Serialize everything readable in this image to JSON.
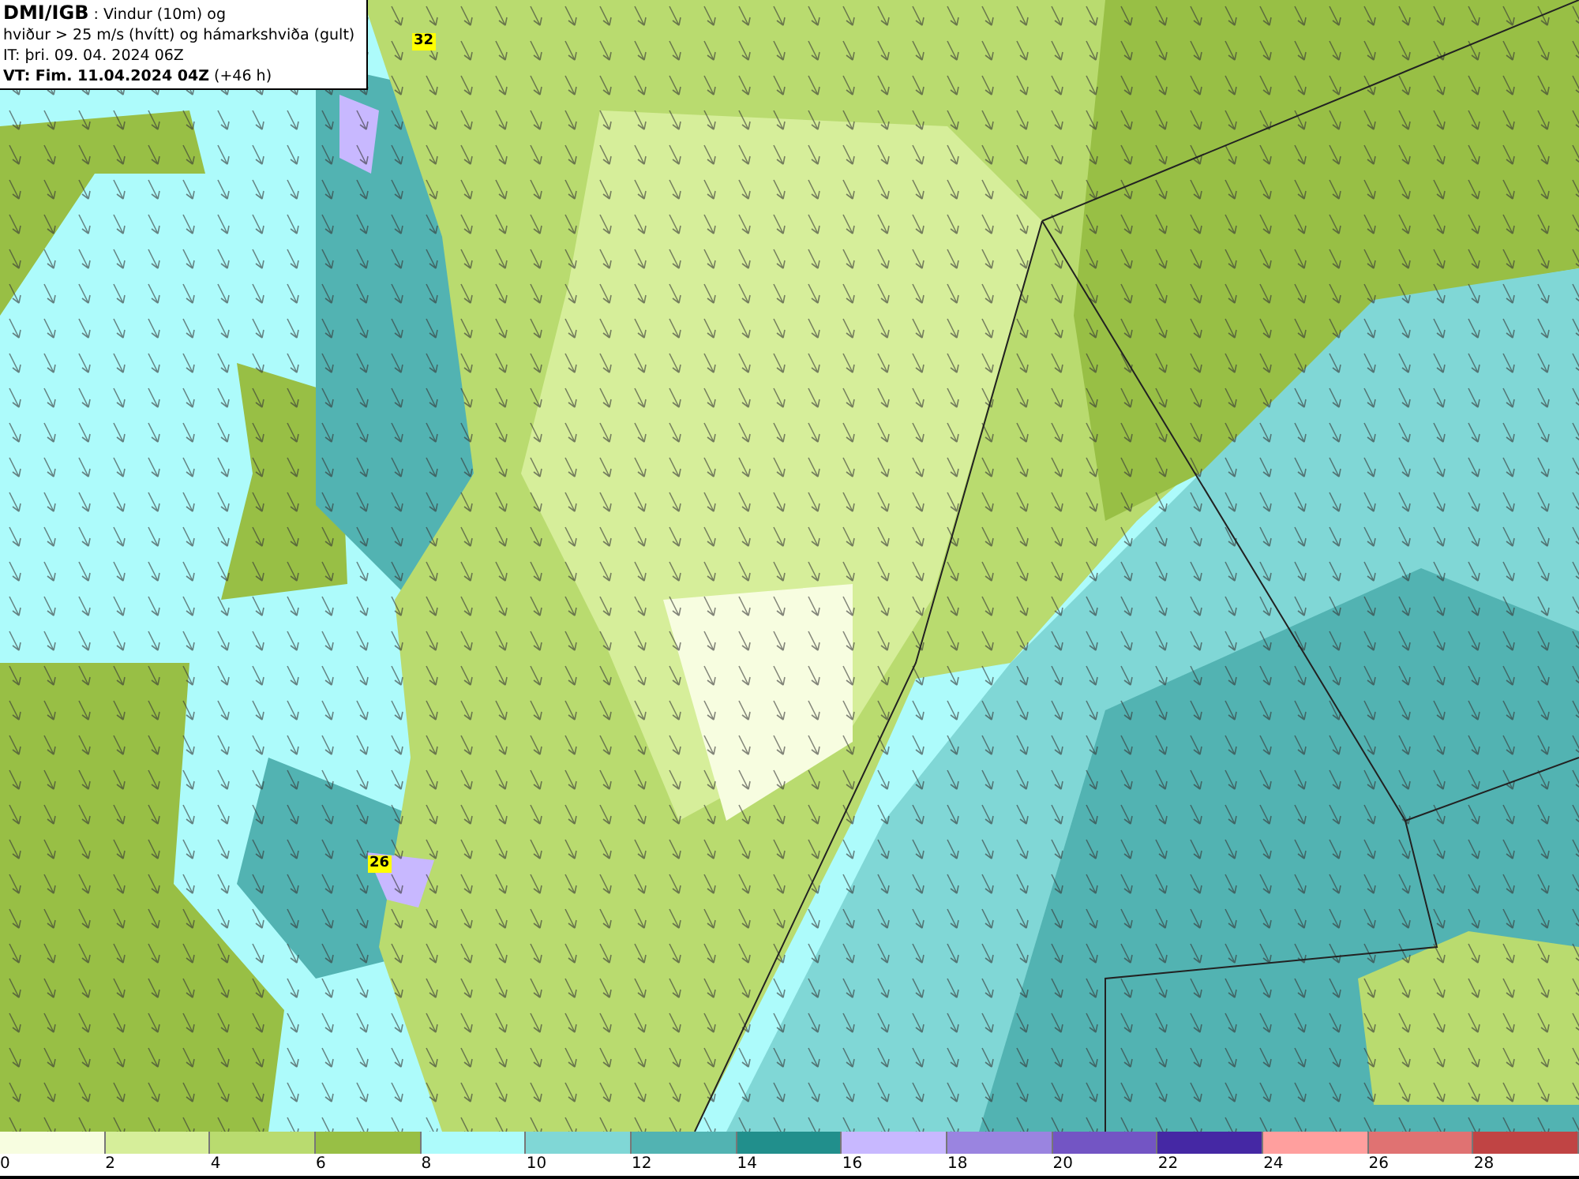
{
  "header": {
    "title_bold": "DMI/IGB",
    "title_rest": " : Vindur (10m) og",
    "line_2": "hviður > 25 m/s (hvítt) og hámarkshviða (gult)",
    "line_3": "IT: þri. 09. 04. 2024 06Z",
    "line_4": "**VT: Fim. 11.04.2024 04Z** (+46 h)"
  },
  "maxima": [
    {
      "value": "32"
    },
    {
      "value": "26"
    }
  ],
  "legend": [
    {
      "label": "0",
      "color": "#f7fde0"
    },
    {
      "label": "2",
      "color": "#d6ee9a"
    },
    {
      "label": "4",
      "color": "#b9db6f"
    },
    {
      "label": "6",
      "color": "#98bf45"
    },
    {
      "label": "8",
      "color": "#adfbfb"
    },
    {
      "label": "10",
      "color": "#80d7d6"
    },
    {
      "label": "12",
      "color": "#52b3b2"
    },
    {
      "label": "14",
      "color": "#218f8c"
    },
    {
      "label": "16",
      "color": "#c8b8ff"
    },
    {
      "label": "18",
      "color": "#9a84e0"
    },
    {
      "label": "20",
      "color": "#7355c4"
    },
    {
      "label": "22",
      "color": "#4528a4"
    },
    {
      "label": "24",
      "color": "#ff9f9e"
    },
    {
      "label": "26",
      "color": "#e07272"
    },
    {
      "label": "28",
      "color": "#c04444"
    }
  ]
}
